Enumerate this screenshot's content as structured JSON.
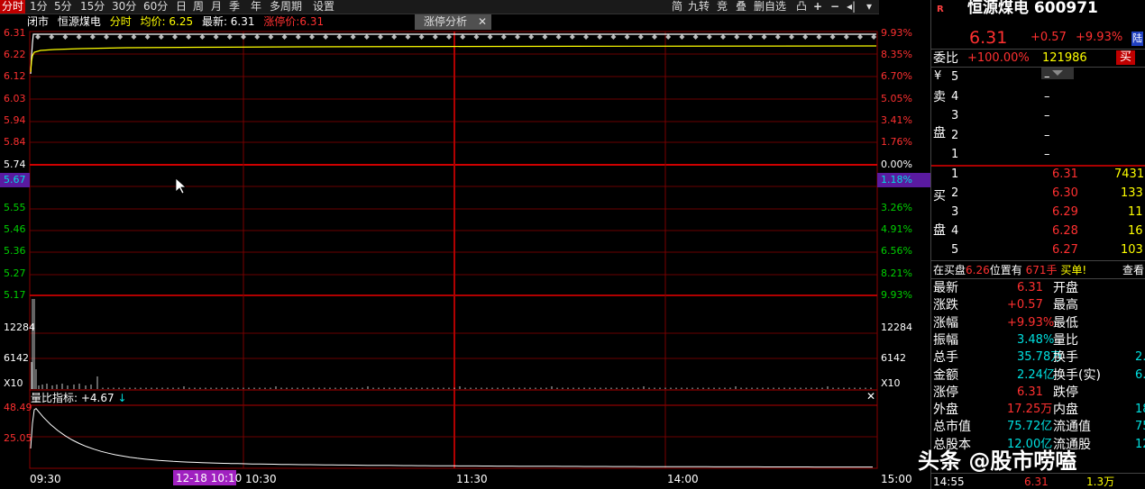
{
  "toolbar": {
    "tabs": [
      "分时",
      "1分",
      "5分",
      "15分",
      "30分",
      "60分",
      "日",
      "周",
      "月",
      "季",
      "年",
      "多周期",
      "设置"
    ],
    "right": [
      "简",
      "九转",
      "竞",
      "叠",
      "删自选",
      "凸",
      "+",
      "−",
      "◂|",
      "▾"
    ]
  },
  "header": {
    "status": "闭市",
    "name": "恒源煤电",
    "type": "分时",
    "avg_label": "均价: 6.25",
    "latest_label": "最新: 6.31",
    "limit_label": "涨停价:6.31",
    "analysis_button": "涨停分析",
    "close": "✕"
  },
  "price_axis_left": [
    "6.31",
    "6.22",
    "6.12",
    "6.03",
    "5.94",
    "5.84",
    "5.74",
    "5.67",
    "5.55",
    "5.46",
    "5.36",
    "5.27",
    "5.17"
  ],
  "price_axis_right": [
    "9.93%",
    "8.35%",
    "6.70%",
    "5.05%",
    "3.41%",
    "1.76%",
    "0.00%",
    "1.18%",
    "3.26%",
    "4.91%",
    "6.56%",
    "8.21%",
    "9.93%"
  ],
  "volume_axis_left": [
    "12284",
    "6142",
    "X10"
  ],
  "volume_axis_right": [
    "12284",
    "6142",
    "X10"
  ],
  "indicator": {
    "label": "量比指标: +4.67",
    "arrow": "↓",
    "axis": [
      "48.49",
      "25.05"
    ],
    "close": "✕"
  },
  "time_axis": [
    "09:30",
    "10:30",
    "11:30",
    "14:00",
    "15:00"
  ],
  "time_cursor": "12-18 10:10",
  "quote": {
    "mark": "R",
    "title": "恒源煤电 600971",
    "price": "6.31",
    "change": "+0.57",
    "change_pct": "+9.93%",
    "badge": "陆",
    "weibi_label": "委比",
    "weibi": "+100.00%",
    "weicha": "121986",
    "buy_btn": "买",
    "sell_side_label": [
      "¥",
      "卖",
      "盘"
    ],
    "sell": [
      {
        "lvl": "5",
        "price": "–",
        "vol": ""
      },
      {
        "lvl": "4",
        "price": "–",
        "vol": ""
      },
      {
        "lvl": "3",
        "price": "–",
        "vol": ""
      },
      {
        "lvl": "2",
        "price": "–",
        "vol": ""
      },
      {
        "lvl": "1",
        "price": "–",
        "vol": ""
      }
    ],
    "buy_side_label": [
      "买",
      "盘"
    ],
    "buy": [
      {
        "lvl": "1",
        "price": "6.31",
        "vol": "7431"
      },
      {
        "lvl": "2",
        "price": "6.30",
        "vol": "133"
      },
      {
        "lvl": "3",
        "price": "6.29",
        "vol": "11"
      },
      {
        "lvl": "4",
        "price": "6.28",
        "vol": "16"
      },
      {
        "lvl": "5",
        "price": "6.27",
        "vol": "103"
      }
    ],
    "notice": {
      "prefix": "在买盘",
      "price": "6.26",
      "mid": "位置有",
      "vol": "671手",
      "suffix": "买单!",
      "link": "查看"
    },
    "stats": [
      {
        "l": "最新",
        "v": "6.31",
        "l2": "开盘",
        "v2": ""
      },
      {
        "l": "涨跌",
        "v": "+0.57",
        "l2": "最高",
        "v2": ""
      },
      {
        "l": "涨幅",
        "v": "+9.93%",
        "l2": "最低",
        "v2": ""
      },
      {
        "l": "振幅",
        "v": "3.48%",
        "l2": "量比",
        "v2": ""
      },
      {
        "l": "总手",
        "v": "35.78万",
        "l2": "换手",
        "v2": "2."
      },
      {
        "l": "金额",
        "v": "2.24亿",
        "l2": "换手(实)",
        "v2": "6."
      },
      {
        "l": "涨停",
        "v": "6.31",
        "l2": "跌停",
        "v2": ""
      },
      {
        "l": "外盘",
        "v": "17.25万",
        "l2": "内盘",
        "v2": "18."
      },
      {
        "l": "总市值",
        "v": "75.72亿",
        "l2": "流通值",
        "v2": "75."
      },
      {
        "l": "总股本",
        "v": "12.00亿",
        "l2": "流通股",
        "v2": "12."
      }
    ],
    "tick": {
      "time": "14:55",
      "price": "6.31",
      "vol": "1.3万"
    }
  },
  "watermark": "头条 @股市唠嗑",
  "colors": {
    "up": "#ff3030",
    "down": "#00d000",
    "grid": "#7a0000",
    "bg": "#000000",
    "accent": "#ffff00"
  }
}
